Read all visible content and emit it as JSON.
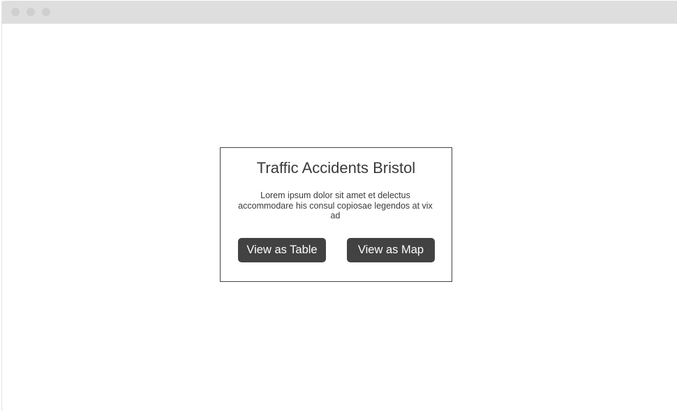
{
  "card": {
    "title": "Traffic Accidents Bristol",
    "description": "Lorem ipsum dolor sit amet et delectus accommodare his consul copiosae legendos at vix ad",
    "buttons": {
      "table_label": "View as Table",
      "map_label": "View as Map"
    }
  },
  "colors": {
    "titlebar": "#dedede",
    "button_bg": "#424242",
    "button_text": "#ffffff",
    "card_border": "#444444",
    "text": "#3a3a3a"
  }
}
